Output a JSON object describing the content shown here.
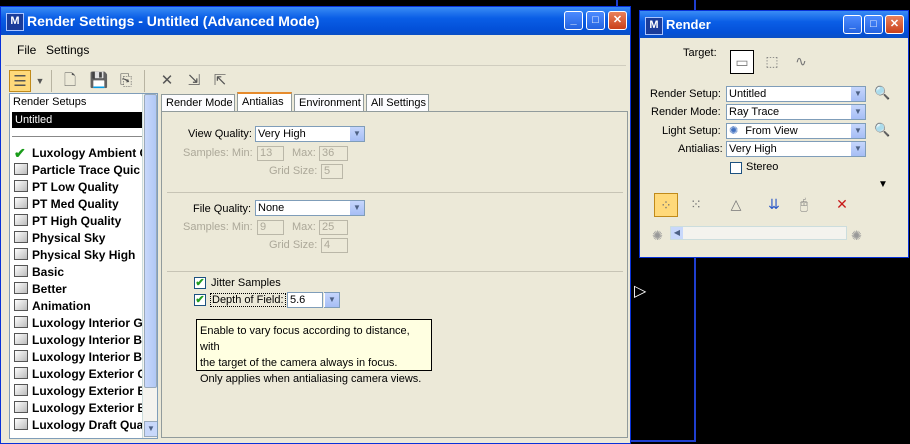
{
  "main_window": {
    "title": "Render Settings - Untitled (Advanced Mode)",
    "menu": [
      "File",
      "Settings"
    ]
  },
  "setups_panel": {
    "header": "Render Setups",
    "selected": "Untitled",
    "items": [
      "Luxology Ambient O",
      "Particle Trace Quic",
      "PT Low Quality",
      "PT Med Quality",
      "PT High Quality",
      "Physical Sky",
      "Physical Sky High",
      "Basic",
      "Better",
      "Animation",
      "Luxology Interior G",
      "Luxology Interior B",
      "Luxology Interior B",
      "Luxology Exterior G",
      "Luxology Exterior B",
      "Luxology Exterior B",
      "Luxology Draft Qua"
    ]
  },
  "tabs": [
    "Render Mode",
    "Antialias",
    "Environment",
    "All Settings"
  ],
  "antialias": {
    "view_quality_label": "View Quality:",
    "view_quality": "Very High",
    "samples_min_label": "Samples: Min:",
    "view_min": "13",
    "max_label": "Max:",
    "view_max": "36",
    "grid_size_label": "Grid Size:",
    "view_grid": "5",
    "file_quality_label": "File Quality:",
    "file_quality": "None",
    "file_min": "9",
    "file_max": "25",
    "file_grid": "4",
    "jitter_label": "Jitter Samples",
    "dof_label": "Depth of Field:",
    "dof_value": "5.6",
    "tooltip": "Enable to vary focus according to distance, with\nthe target of the camera always in focus.\nOnly applies when antialiasing camera views."
  },
  "render_window": {
    "title": "Render",
    "target_label": "Target:",
    "render_setup_label": "Render Setup:",
    "render_setup": "Untitled",
    "render_mode_label": "Render Mode:",
    "render_mode": "Ray Trace",
    "light_setup_label": "Light Setup:",
    "light_setup": "From View",
    "antialias_label": "Antialias:",
    "antialias": "Very High",
    "stereo_label": "Stereo"
  },
  "colors": {
    "title_blue": "#0a5ee6",
    "dialog_bg": "#ece9d8",
    "selection_bg": "#000000",
    "tooltip_bg": "#ffffe1",
    "tab_active_accent": "#e68b2c"
  }
}
